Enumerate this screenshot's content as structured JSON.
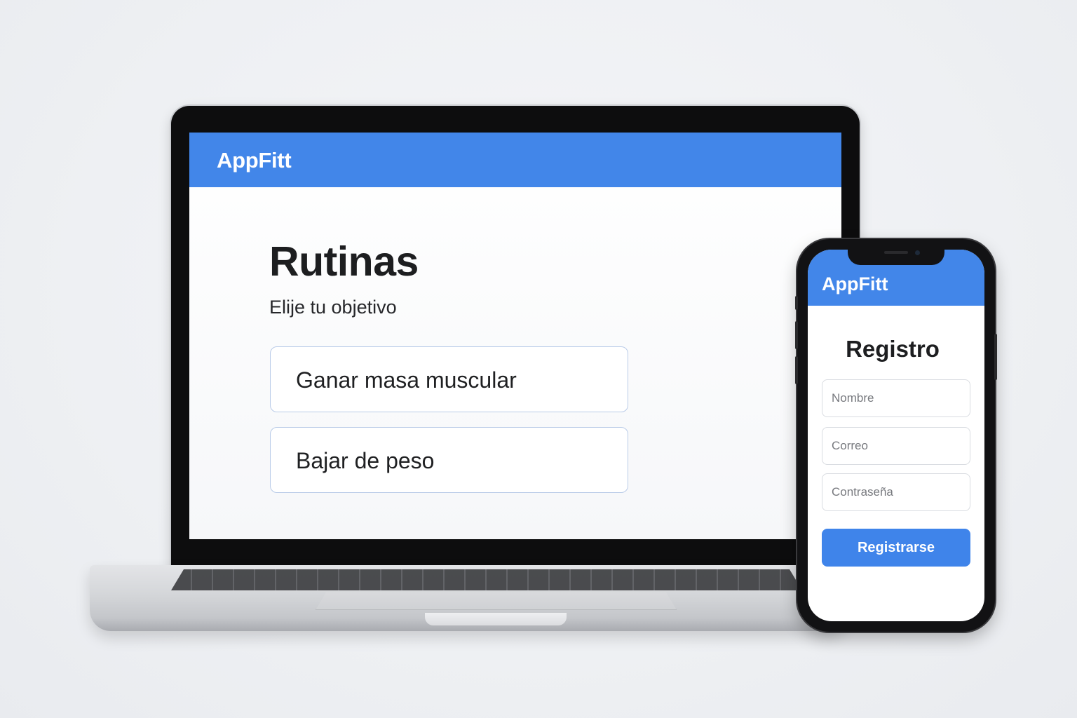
{
  "colors": {
    "accent": "#4286e9",
    "button": "#3f84ea",
    "text_primary": "#1d1e20",
    "placeholder": "#77797e"
  },
  "laptop": {
    "brand": "AppFitt",
    "title": "Rutinas",
    "subtitle": "Elije tu objetivo",
    "goals": [
      {
        "label": "Ganar masa muscular"
      },
      {
        "label": "Bajar de peso"
      }
    ]
  },
  "phone": {
    "brand": "AppFitt",
    "title": "Registro",
    "fields": [
      {
        "placeholder": "Nombre"
      },
      {
        "placeholder": "Correo"
      },
      {
        "placeholder": "Contraseña"
      }
    ],
    "submit_label": "Registrarse"
  }
}
